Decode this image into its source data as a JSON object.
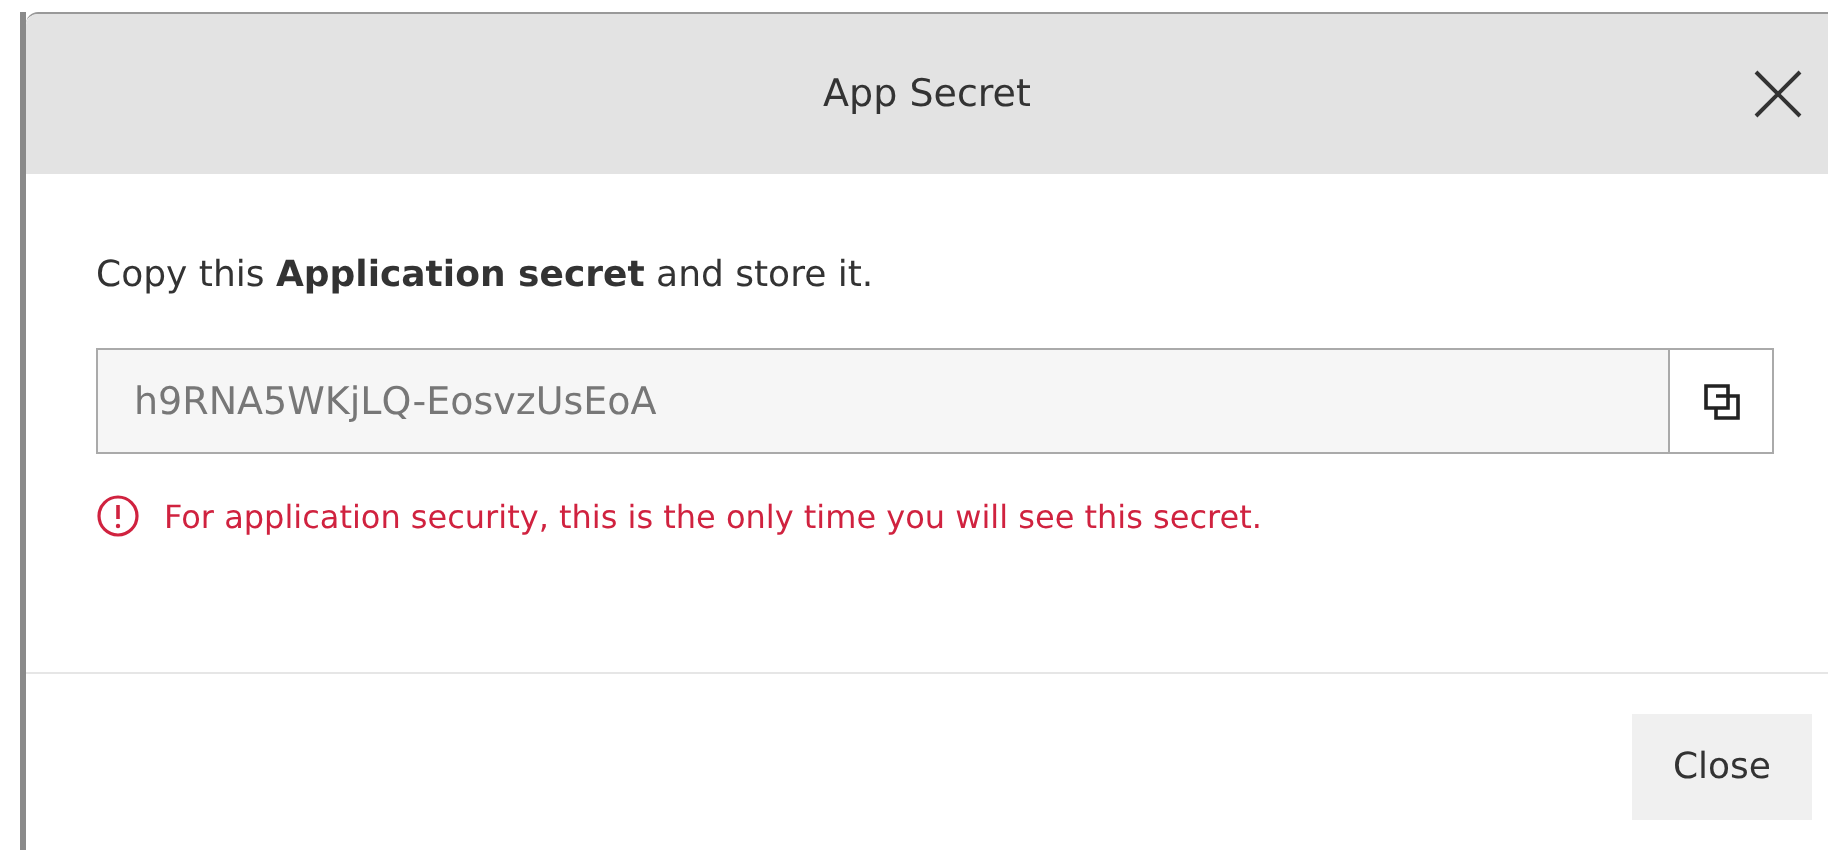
{
  "dialog": {
    "title": "App Secret",
    "instruction": "Copy this **Application secret** and store it.",
    "secret_field": {
      "value": "h9RNA5WKjLQ-EosvzUsEoA"
    },
    "warning": "For application security, this is the only time you will see this secret.",
    "buttons": [
      "Close"
    ]
  }
}
